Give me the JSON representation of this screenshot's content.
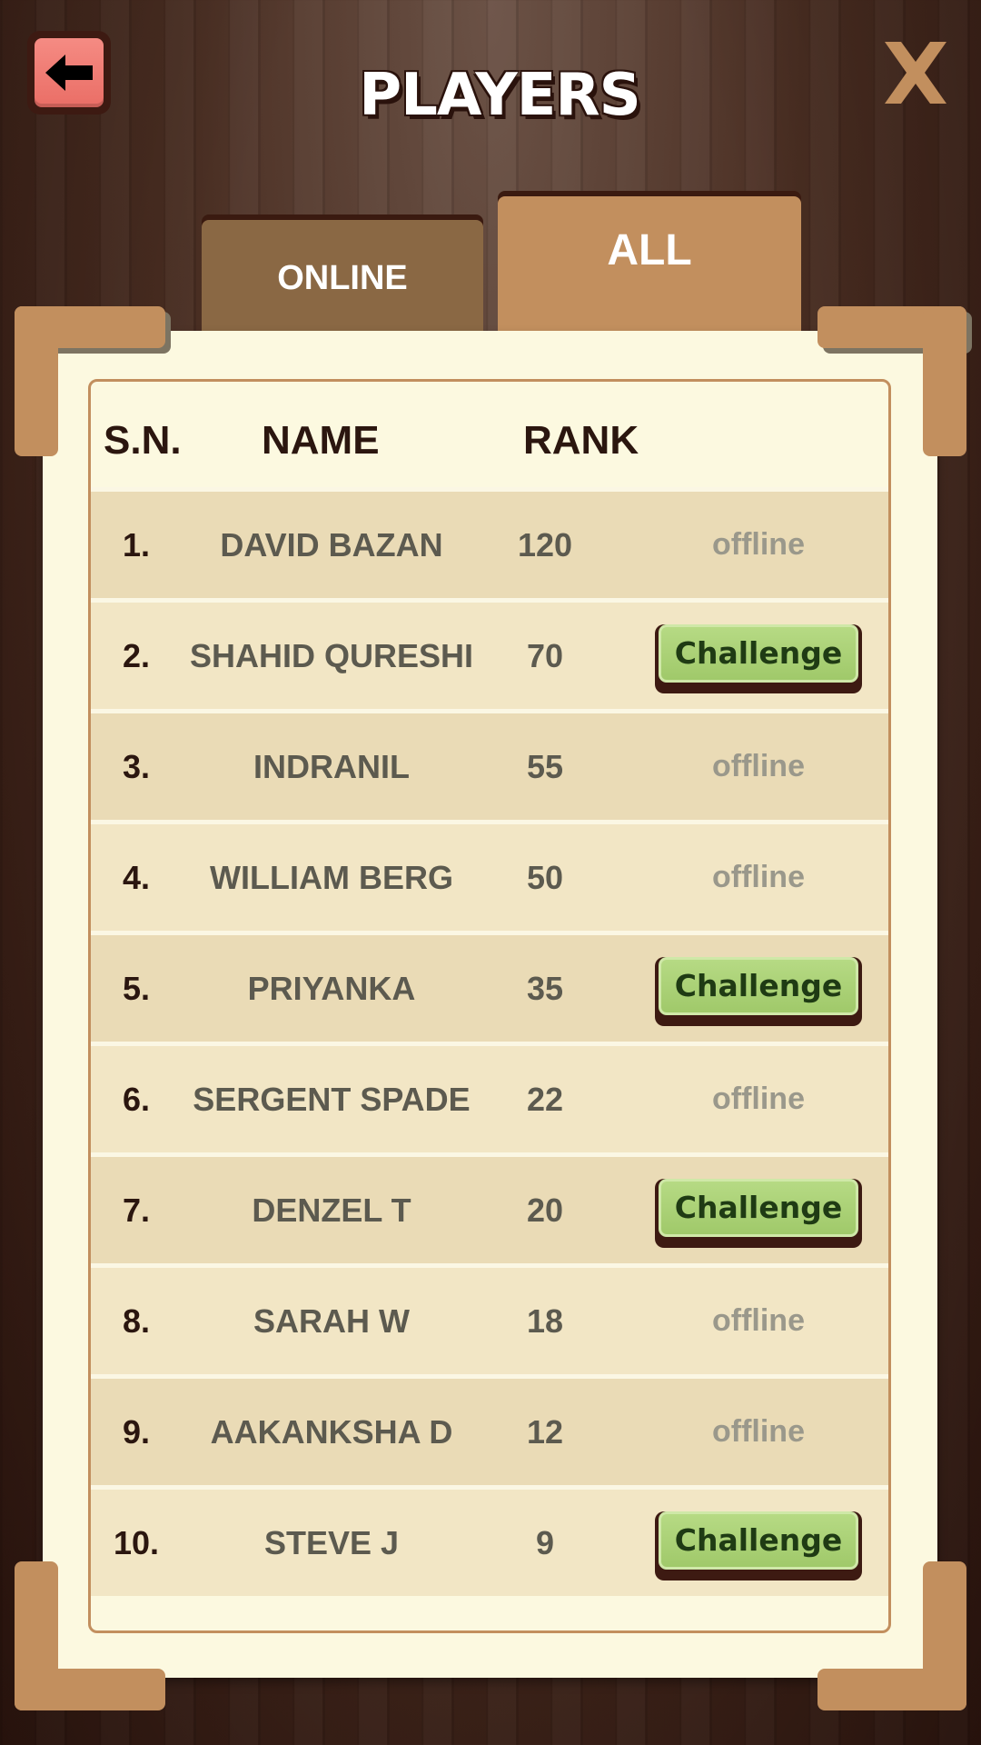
{
  "header": {
    "title": "PLAYERS",
    "back_icon": "arrow-left-icon",
    "close_icon": "close-x-icon"
  },
  "tabs": [
    {
      "label": "ONLINE",
      "active": false
    },
    {
      "label": "ALL",
      "active": true
    }
  ],
  "table": {
    "headers": {
      "sn": "S.N.",
      "name": "NAME",
      "rank": "RANK"
    },
    "rows": [
      {
        "sn": "1.",
        "name": "DAVID BAZAN",
        "rank": "120",
        "status": "offline"
      },
      {
        "sn": "2.",
        "name": "SHAHID QURESHI",
        "rank": "70",
        "status": "Challenge"
      },
      {
        "sn": "3.",
        "name": "INDRANIL",
        "rank": "55",
        "status": "offline"
      },
      {
        "sn": "4.",
        "name": "WILLIAM BERG",
        "rank": "50",
        "status": "offline"
      },
      {
        "sn": "5.",
        "name": "PRIYANKA",
        "rank": "35",
        "status": "Challenge"
      },
      {
        "sn": "6.",
        "name": "SERGENT SPADE",
        "rank": "22",
        "status": "offline"
      },
      {
        "sn": "7.",
        "name": "DENZEL T",
        "rank": "20",
        "status": "Challenge"
      },
      {
        "sn": "8.",
        "name": "SARAH W",
        "rank": "18",
        "status": "offline"
      },
      {
        "sn": "9.",
        "name": "AAKANKSHA D",
        "rank": "12",
        "status": "offline"
      },
      {
        "sn": "10.",
        "name": "STEVE J",
        "rank": "9",
        "status": "Challenge"
      }
    ]
  },
  "colors": {
    "accent_tan": "#c28f5e",
    "panel_cream": "#fcf9e0",
    "challenge_green": "#a0c96a",
    "back_button_red": "#ea6e66"
  }
}
